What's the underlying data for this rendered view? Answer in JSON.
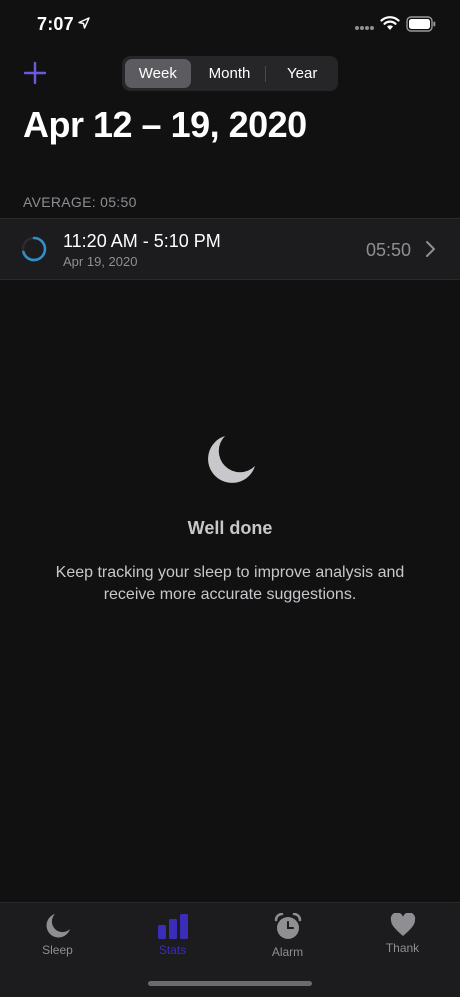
{
  "status_bar": {
    "time": "7:07"
  },
  "header": {
    "segments": [
      {
        "label": "Week",
        "active": true
      },
      {
        "label": "Month",
        "active": false
      },
      {
        "label": "Year",
        "active": false
      }
    ],
    "title": "Apr 12 – 19, 2020"
  },
  "summary": {
    "average_label": "AVERAGE: 05:50"
  },
  "entries": [
    {
      "time_range": "11:20 AM - 5:10 PM",
      "date": "Apr 19, 2020",
      "duration": "05:50"
    }
  ],
  "empty_state": {
    "title": "Well done",
    "message": "Keep tracking your sleep to improve analysis and receive more accurate suggestions."
  },
  "tabs": [
    {
      "label": "Sleep",
      "icon": "moon-icon",
      "active": false
    },
    {
      "label": "Stats",
      "icon": "bar-chart-icon",
      "active": true
    },
    {
      "label": "Alarm",
      "icon": "alarm-clock-icon",
      "active": false
    },
    {
      "label": "Thank",
      "icon": "heart-icon",
      "active": false
    }
  ],
  "colors": {
    "accent": "#3a2eb8",
    "add_button": "#6a5ae0",
    "background": "#111112"
  }
}
